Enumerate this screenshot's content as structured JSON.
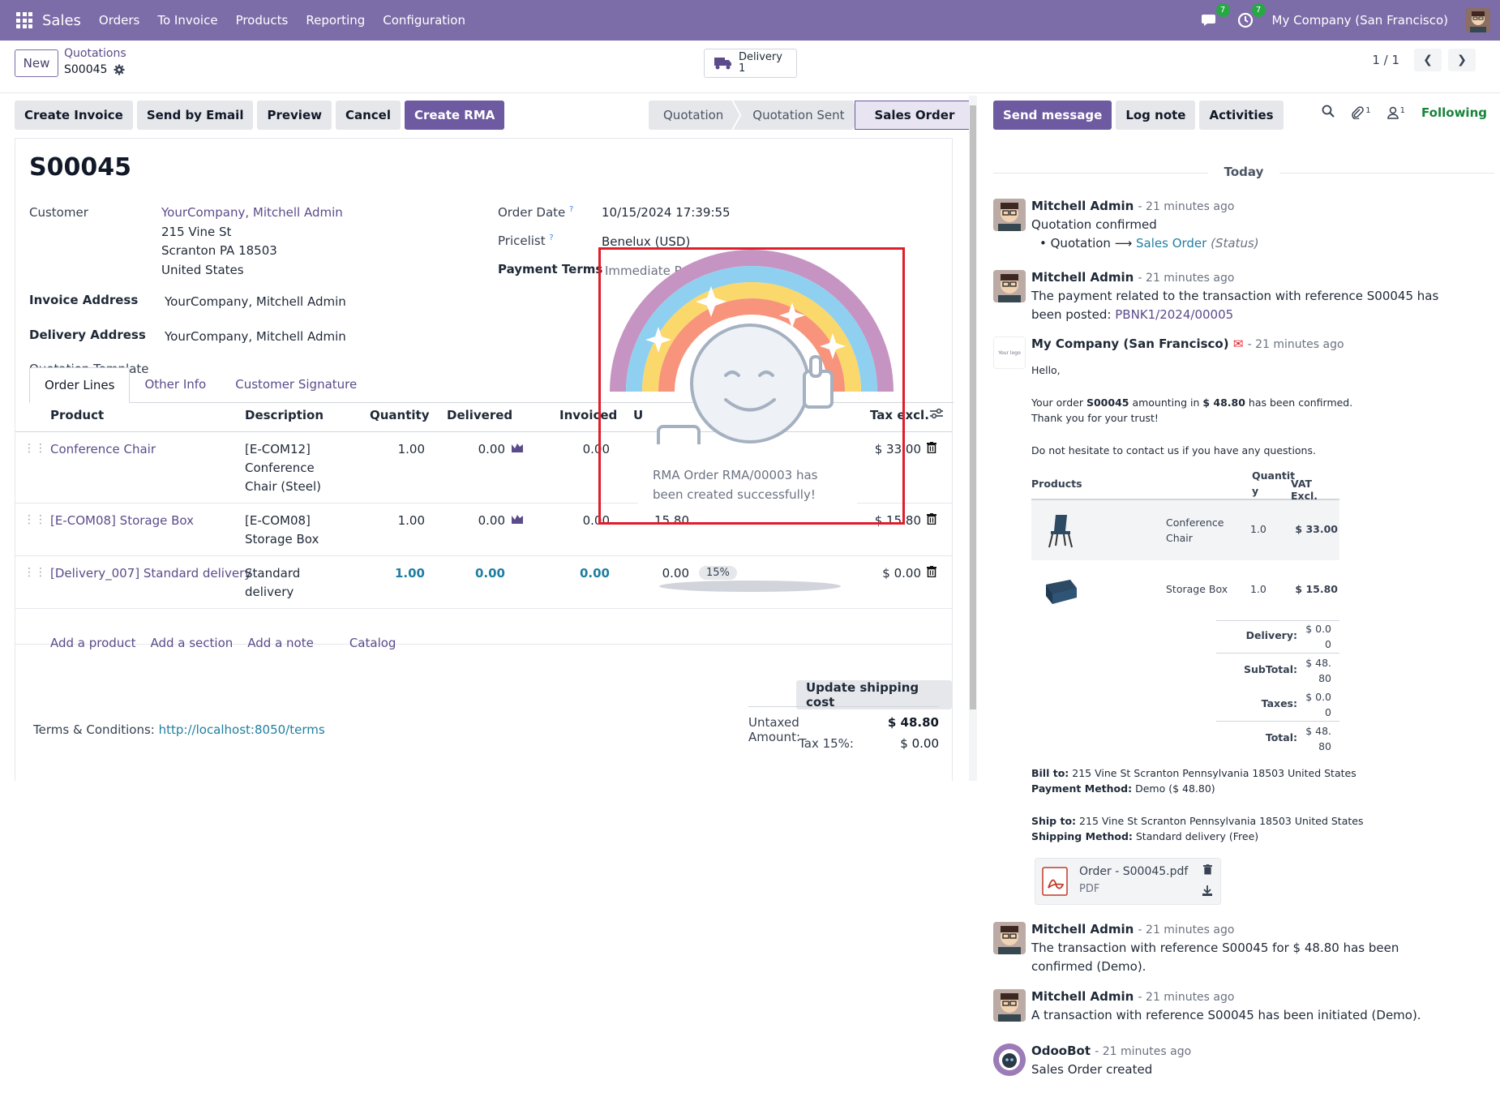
{
  "navbar": {
    "brand": "Sales",
    "menu": [
      "Orders",
      "To Invoice",
      "Products",
      "Reporting",
      "Configuration"
    ],
    "messages_count": "7",
    "activities_count": "7",
    "company": "My Company (San Francisco)"
  },
  "control": {
    "new_label": "New",
    "breadcrumb_parent": "Quotations",
    "breadcrumb_current": "S00045",
    "smart_delivery_label": "Delivery",
    "smart_delivery_count": "1",
    "pager": "1 / 1"
  },
  "actions": {
    "create_invoice": "Create Invoice",
    "send_email": "Send by Email",
    "preview": "Preview",
    "cancel": "Cancel",
    "create_rma": "Create RMA"
  },
  "stages": [
    "Quotation",
    "Quotation Sent",
    "Sales Order"
  ],
  "form": {
    "title": "S00045",
    "customer_label": "Customer",
    "customer_name": "YourCompany, Mitchell Admin",
    "customer_street": "215 Vine St",
    "customer_city": "Scranton PA 18503",
    "customer_country": "United States",
    "invoice_label": "Invoice Address",
    "invoice_value": "YourCompany, Mitchell Admin",
    "delivery_label": "Delivery Address",
    "delivery_value": "YourCompany, Mitchell Admin",
    "template_label": "Quotation Template",
    "order_date_label": "Order Date",
    "order_date_value": "10/15/2024 17:39:55",
    "pricelist_label": "Pricelist",
    "pricelist_value": "Benelux (USD)",
    "payment_terms_label": "Payment Terms",
    "payment_terms_value": "Immediate Pa",
    "help_mark": "?"
  },
  "tabs": [
    "Order Lines",
    "Other Info",
    "Customer Signature"
  ],
  "order_lines": {
    "headers": {
      "product": "Product",
      "description": "Description",
      "quantity": "Quantity",
      "delivered": "Delivered",
      "invoiced": "Invoiced",
      "unit": "U",
      "tax_excl": "Tax excl."
    },
    "rows": [
      {
        "product": "Conference Chair",
        "desc1": "[E-COM12]",
        "desc2": "Conference",
        "desc3": "Chair (Steel)",
        "qty": "1.00",
        "delivered": "0.00",
        "invoiced": "0.00",
        "price": "",
        "tax": "",
        "subtotal": "$ 33.00"
      },
      {
        "product": "[E-COM08] Storage Box",
        "desc1": "[E-COM08]",
        "desc2": "Storage Box",
        "desc3": "",
        "qty": "1.00",
        "delivered": "0.00",
        "invoiced": "0.00",
        "price": "15.80",
        "tax": "",
        "subtotal": "$ 15.80"
      },
      {
        "product": "[Delivery_007] Standard delivery",
        "desc1": "Standard",
        "desc2": "delivery",
        "desc3": "",
        "qty": "1.00",
        "delivered": "0.00",
        "invoiced": "0.00",
        "price": "0.00",
        "tax": "15%",
        "subtotal": "$ 0.00"
      }
    ],
    "add_product": "Add a product",
    "add_section": "Add a section",
    "add_note": "Add a note",
    "catalog": "Catalog"
  },
  "footer": {
    "update_shipping": "Update shipping cost",
    "terms_label": "Terms & Conditions:",
    "terms_link": "http://localhost:8050/terms",
    "untaxed_label": "Untaxed Amount:",
    "untaxed_value": "$ 48.80",
    "tax_label": "Tax 15%:",
    "tax_value": "$ 0.00"
  },
  "popup": {
    "message": "RMA Order RMA/00003 has been created successfully!"
  },
  "chatter": {
    "send_message": "Send message",
    "log_note": "Log note",
    "activities": "Activities",
    "attachments_count": "1",
    "followers_count": "1",
    "following": "Following",
    "today": "Today",
    "messages": [
      {
        "author": "Mitchell Admin",
        "ago": "- 21 minutes ago",
        "body": "Quotation confirmed"
      },
      {
        "author": "Mitchell Admin",
        "ago": "- 21 minutes ago",
        "body": "The payment related to the transaction with reference S00045 has been posted:",
        "link": "PBNK1/2024/00005"
      },
      {
        "author": "My Company (San Francisco)",
        "ago": "- 21 minutes ago"
      },
      {
        "author": "Mitchell Admin",
        "ago": "- 21 minutes ago",
        "body": "The transaction with reference S00045 for $ 48.80 has been confirmed (Demo)."
      },
      {
        "author": "Mitchell Admin",
        "ago": "- 21 minutes ago",
        "body": "A transaction with reference S00045 has been initiated (Demo)."
      },
      {
        "author": "OdooBot",
        "ago": "- 21 minutes ago",
        "body": "Sales Order created"
      }
    ],
    "tracking_old": "Quotation",
    "tracking_new": "Sales Order",
    "tracking_field": "(Status)",
    "logo_text": "Your logo"
  },
  "email": {
    "hello": "Hello,",
    "line1_pre": "Your order ",
    "line1_ref": "S00045",
    "line1_mid": " amounting in ",
    "line1_amt": "$ 48.80",
    "line1_post": " has been confirmed.",
    "line2": "Thank you for your trust!",
    "line3": "Do not hesitate to contact us if you have any questions.",
    "col_products": "Products",
    "col_qty1": "Quantit",
    "col_qty2": "y",
    "col_vat": "VAT Excl.",
    "rows": [
      {
        "name1": "Conference",
        "name2": "Chair",
        "qty": "1.0",
        "vat": "$ 33.00"
      },
      {
        "name1": "Storage Box",
        "name2": "",
        "qty": "1.0",
        "vat": "$ 15.80"
      }
    ],
    "delivery_label": "Delivery:",
    "delivery_v1": "$ 0.0",
    "delivery_v2": "0",
    "subtotal_label": "SubTotal:",
    "subtotal_v1": "$ 48.",
    "subtotal_v2": "80",
    "taxes_label": "Taxes:",
    "taxes_v1": "$ 0.0",
    "taxes_v2": "0",
    "total_label": "Total:",
    "total_v1": "$ 48.",
    "total_v2": "80",
    "bill_to_label": "Bill to:",
    "bill_to_value": "215 Vine St Scranton Pennsylvania 18503 United States",
    "payment_method_label": "Payment Method:",
    "payment_method_value": "Demo ($ 48.80)",
    "ship_to_label": "Ship to:",
    "ship_to_value": "215 Vine St Scranton Pennsylvania 18503 United States",
    "shipping_method_label": "Shipping Method:",
    "shipping_method_value": "Standard delivery (Free)",
    "attachment_name": "Order - S00045.pdf",
    "attachment_type": "PDF"
  },
  "colors": {
    "navbar": "#7c6ca8",
    "primary": "#6d5aa0",
    "following": "#16843b",
    "highlight_box": "#e11d2a"
  }
}
